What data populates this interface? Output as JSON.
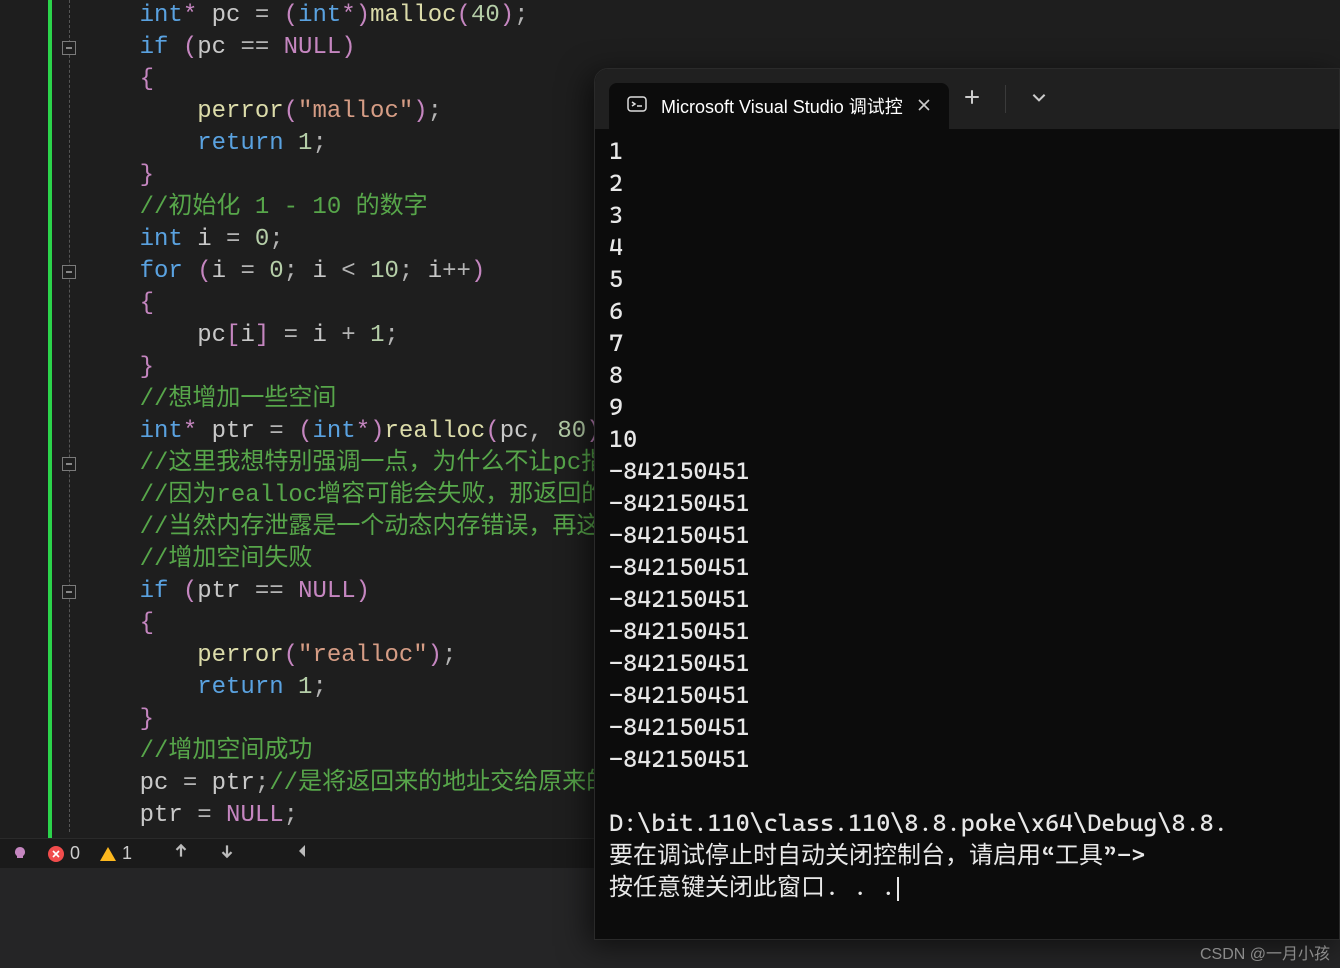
{
  "code": {
    "lines": [
      {
        "indent": 1,
        "tokens": [
          [
            "kw",
            "int"
          ],
          [
            "ptr",
            "* "
          ],
          [
            "ident",
            "pc"
          ],
          [
            "op",
            " = "
          ],
          [
            "paren",
            "("
          ],
          [
            "kw",
            "int"
          ],
          [
            "ptr",
            "*"
          ],
          [
            "paren",
            ")"
          ],
          [
            "func",
            "malloc"
          ],
          [
            "paren",
            "("
          ],
          [
            "num",
            "40"
          ],
          [
            "paren",
            ")"
          ],
          [
            "semi",
            ";"
          ]
        ]
      },
      {
        "indent": 1,
        "tokens": [
          [
            "kw",
            "if"
          ],
          [
            "op",
            " "
          ],
          [
            "paren",
            "("
          ],
          [
            "ident",
            "pc"
          ],
          [
            "op",
            " == "
          ],
          [
            "ptr",
            "NULL"
          ],
          [
            "paren",
            ")"
          ]
        ]
      },
      {
        "indent": 1,
        "tokens": [
          [
            "brace",
            "{"
          ]
        ]
      },
      {
        "indent": 2,
        "tokens": [
          [
            "func",
            "perror"
          ],
          [
            "paren",
            "("
          ],
          [
            "str",
            "\"malloc\""
          ],
          [
            "paren",
            ")"
          ],
          [
            "semi",
            ";"
          ]
        ]
      },
      {
        "indent": 2,
        "tokens": [
          [
            "kw",
            "return"
          ],
          [
            "op",
            " "
          ],
          [
            "num",
            "1"
          ],
          [
            "semi",
            ";"
          ]
        ]
      },
      {
        "indent": 1,
        "tokens": [
          [
            "brace",
            "}"
          ]
        ]
      },
      {
        "indent": 1,
        "tokens": [
          [
            "cmt",
            "//初始化 1 - 10 的数字"
          ]
        ]
      },
      {
        "indent": 1,
        "tokens": [
          [
            "kw",
            "int"
          ],
          [
            "op",
            " "
          ],
          [
            "ident",
            "i"
          ],
          [
            "op",
            " = "
          ],
          [
            "num",
            "0"
          ],
          [
            "semi",
            ";"
          ]
        ]
      },
      {
        "indent": 1,
        "tokens": [
          [
            "kw",
            "for"
          ],
          [
            "op",
            " "
          ],
          [
            "paren",
            "("
          ],
          [
            "ident",
            "i"
          ],
          [
            "op",
            " = "
          ],
          [
            "num",
            "0"
          ],
          [
            "semi",
            "; "
          ],
          [
            "ident",
            "i"
          ],
          [
            "op",
            " < "
          ],
          [
            "num",
            "10"
          ],
          [
            "semi",
            "; "
          ],
          [
            "ident",
            "i"
          ],
          [
            "op",
            "++"
          ],
          [
            "paren",
            ")"
          ]
        ]
      },
      {
        "indent": 1,
        "tokens": [
          [
            "brace",
            "{"
          ]
        ]
      },
      {
        "indent": 2,
        "tokens": [
          [
            "ident",
            "pc"
          ],
          [
            "paren",
            "["
          ],
          [
            "ident",
            "i"
          ],
          [
            "paren",
            "]"
          ],
          [
            "op",
            " = "
          ],
          [
            "ident",
            "i"
          ],
          [
            "op",
            " + "
          ],
          [
            "num",
            "1"
          ],
          [
            "semi",
            ";"
          ]
        ]
      },
      {
        "indent": 1,
        "tokens": [
          [
            "brace",
            "}"
          ]
        ]
      },
      {
        "indent": 1,
        "tokens": [
          [
            "cmt",
            "//想增加一些空间"
          ]
        ]
      },
      {
        "indent": 1,
        "tokens": [
          [
            "kw",
            "int"
          ],
          [
            "ptr",
            "* "
          ],
          [
            "ident",
            "ptr"
          ],
          [
            "op",
            " = "
          ],
          [
            "paren",
            "("
          ],
          [
            "kw",
            "int"
          ],
          [
            "ptr",
            "*"
          ],
          [
            "paren",
            ")"
          ],
          [
            "func",
            "realloc"
          ],
          [
            "paren",
            "("
          ],
          [
            "ident",
            "pc"
          ],
          [
            "op",
            ", "
          ],
          [
            "num",
            "80"
          ],
          [
            "paren",
            ")"
          ],
          [
            "semi",
            ";"
          ]
        ]
      },
      {
        "indent": 1,
        "tokens": [
          [
            "cmt",
            "//这里我想特别强调一点，为什么不让pc指"
          ]
        ]
      },
      {
        "indent": 1,
        "tokens": [
          [
            "cmt",
            "//因为realloc增容可能会失败，那返回的"
          ]
        ]
      },
      {
        "indent": 1,
        "tokens": [
          [
            "cmt",
            "//当然内存泄露是一个动态内存错误，再这"
          ]
        ]
      },
      {
        "indent": 1,
        "tokens": [
          [
            "cmt",
            "//增加空间失败"
          ]
        ]
      },
      {
        "indent": 1,
        "tokens": [
          [
            "kw",
            "if"
          ],
          [
            "op",
            " "
          ],
          [
            "paren",
            "("
          ],
          [
            "ident",
            "ptr"
          ],
          [
            "op",
            " == "
          ],
          [
            "ptr",
            "NULL"
          ],
          [
            "paren",
            ")"
          ]
        ]
      },
      {
        "indent": 1,
        "tokens": [
          [
            "brace",
            "{"
          ]
        ]
      },
      {
        "indent": 2,
        "tokens": [
          [
            "func",
            "perror"
          ],
          [
            "paren",
            "("
          ],
          [
            "str",
            "\"realloc\""
          ],
          [
            "paren",
            ")"
          ],
          [
            "semi",
            ";"
          ]
        ]
      },
      {
        "indent": 2,
        "tokens": [
          [
            "kw",
            "return"
          ],
          [
            "op",
            " "
          ],
          [
            "num",
            "1"
          ],
          [
            "semi",
            ";"
          ]
        ]
      },
      {
        "indent": 1,
        "tokens": [
          [
            "brace",
            "}"
          ]
        ]
      },
      {
        "indent": 1,
        "tokens": [
          [
            "cmt",
            "//增加空间成功"
          ]
        ]
      },
      {
        "indent": 1,
        "tokens": [
          [
            "ident",
            "pc"
          ],
          [
            "op",
            " = "
          ],
          [
            "ident",
            "ptr"
          ],
          [
            "semi",
            ";"
          ],
          [
            "cmt",
            "//是将返回来的地址交给原来的"
          ]
        ]
      },
      {
        "indent": 1,
        "tokens": [
          [
            "ident",
            "ptr"
          ],
          [
            "op",
            " = "
          ],
          [
            "ptr",
            "NULL"
          ],
          [
            "semi",
            ";"
          ]
        ]
      }
    ],
    "folds": [
      {
        "line": 1
      },
      {
        "line": 8
      },
      {
        "line": 14
      },
      {
        "line": 18
      }
    ]
  },
  "status": {
    "errors": "0",
    "warnings": "1"
  },
  "terminal": {
    "tab_title": "Microsoft Visual Studio 调试控",
    "output": [
      "1",
      "2",
      "3",
      "4",
      "5",
      "6",
      "7",
      "8",
      "9",
      "10",
      "-842150451",
      "-842150451",
      "-842150451",
      "-842150451",
      "-842150451",
      "-842150451",
      "-842150451",
      "-842150451",
      "-842150451",
      "-842150451",
      "",
      "D:\\bit.110\\class.110\\8.8.poke\\x64\\Debug\\8.8.",
      "要在调试停止时自动关闭控制台，请启用“工具”->",
      "按任意键关闭此窗口. . ."
    ]
  },
  "watermark": "CSDN @一月小孩"
}
